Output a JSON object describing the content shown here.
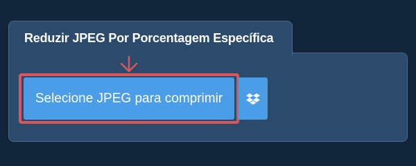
{
  "card": {
    "tab_title": "Reduzir JPEG Por Porcentagem Específica",
    "select_button_label": "Selecione JPEG para comprimir"
  },
  "icons": {
    "pointer": "arrow-down-icon",
    "cloud": "dropbox-icon"
  },
  "colors": {
    "background": "#13253a",
    "panel": "#2c4a6b",
    "button": "#4a9de6",
    "highlight": "#d9575b"
  }
}
